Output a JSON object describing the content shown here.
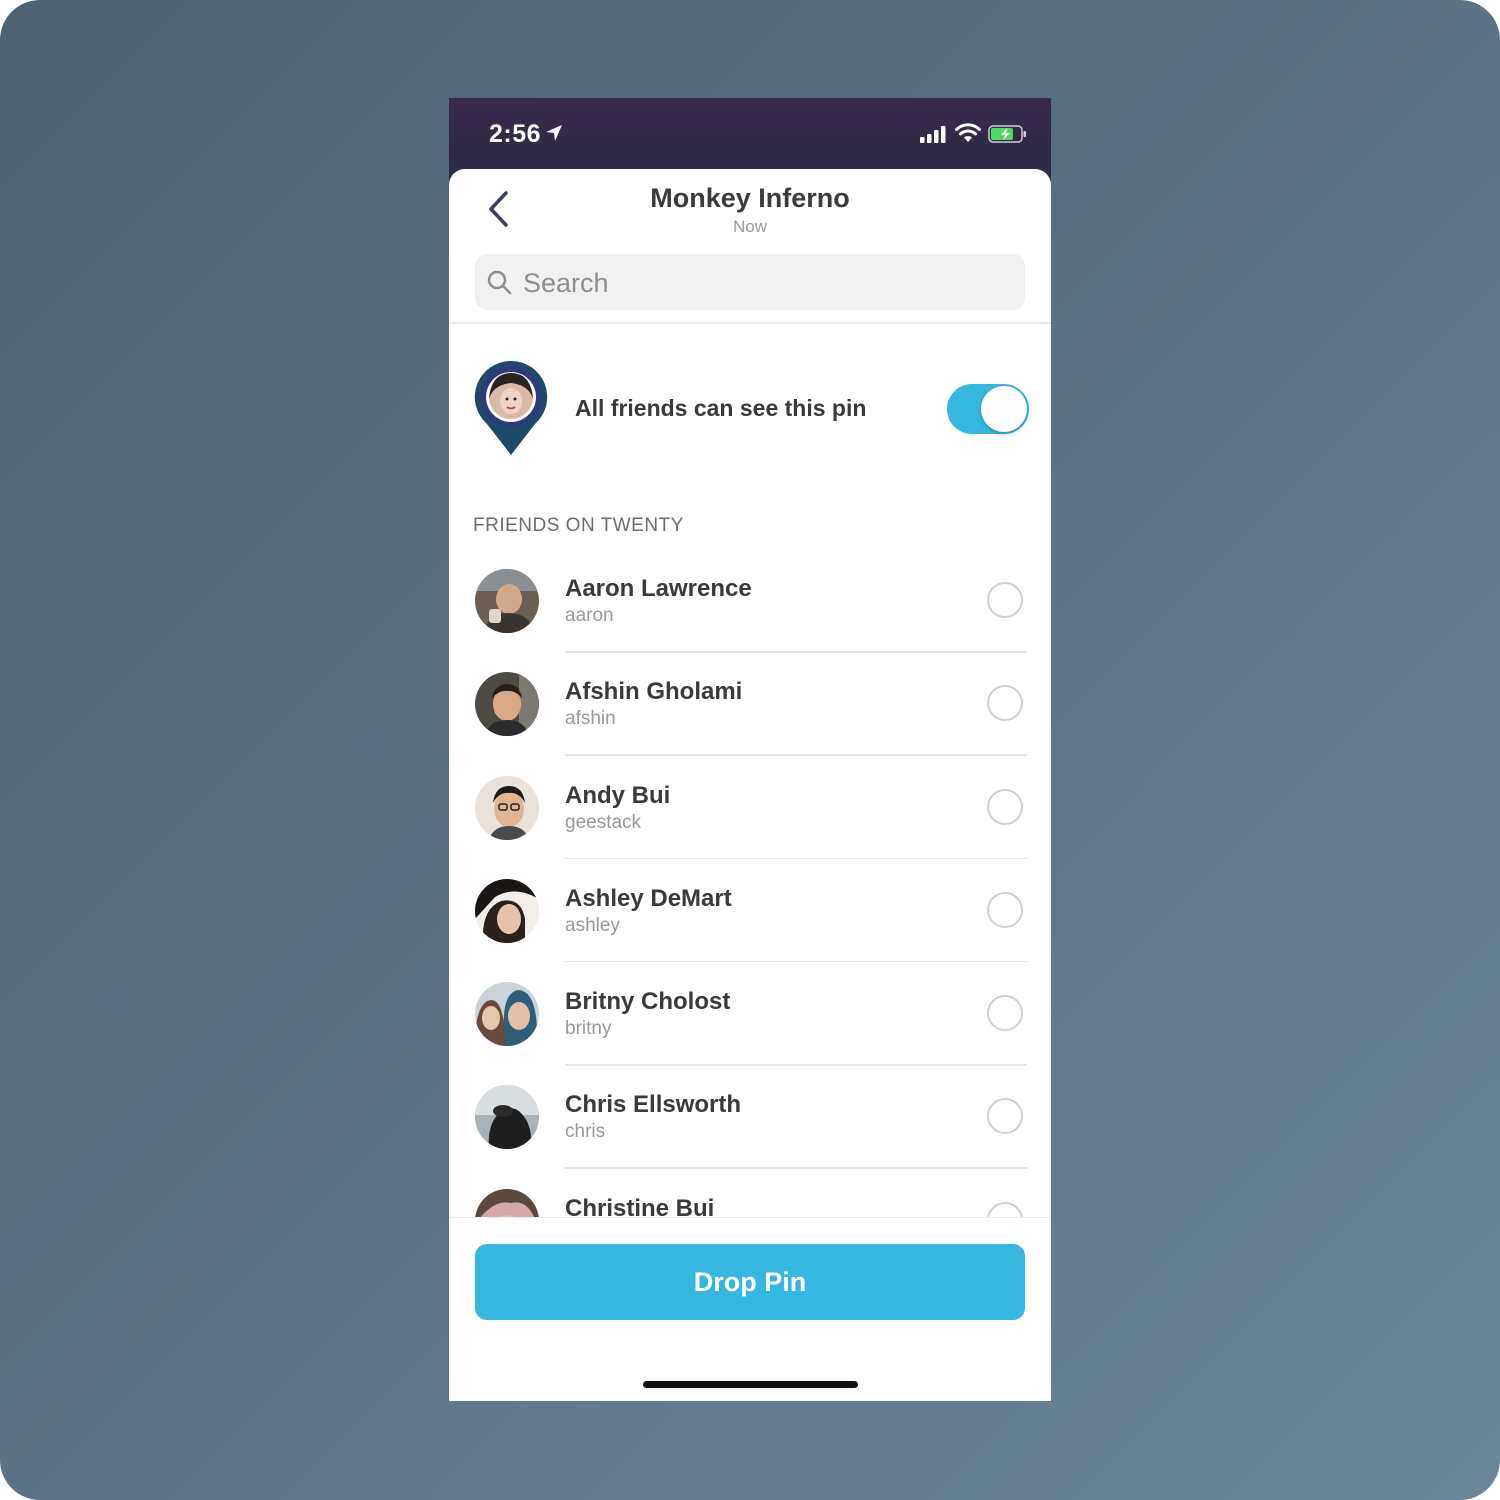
{
  "status_bar": {
    "time": "2:56"
  },
  "header": {
    "title": "Monkey Inferno",
    "subtitle": "Now"
  },
  "search": {
    "placeholder": "Search"
  },
  "visibility": {
    "label": "All friends can see this pin",
    "enabled": true
  },
  "friends_section": {
    "header": "FRIENDS ON TWENTY",
    "friends": [
      {
        "name": "Aaron Lawrence",
        "handle": "aaron",
        "selected": false
      },
      {
        "name": "Afshin Gholami",
        "handle": "afshin",
        "selected": false
      },
      {
        "name": "Andy Bui",
        "handle": "geestack",
        "selected": false
      },
      {
        "name": "Ashley DeMart",
        "handle": "ashley",
        "selected": false
      },
      {
        "name": "Britny Cholost",
        "handle": "britny",
        "selected": false
      },
      {
        "name": "Chris Ellsworth",
        "handle": "chris",
        "selected": false
      },
      {
        "name": "Christine Bui",
        "handle": "",
        "selected": false
      }
    ]
  },
  "actions": {
    "drop_pin": "Drop Pin"
  },
  "colors": {
    "accent": "#36b7df",
    "pin": "#1d4a6b"
  },
  "icons": [
    "location-arrow-icon",
    "signal-icon",
    "wifi-icon",
    "battery-icon",
    "back-chevron-icon",
    "search-icon",
    "map-pin-icon"
  ]
}
